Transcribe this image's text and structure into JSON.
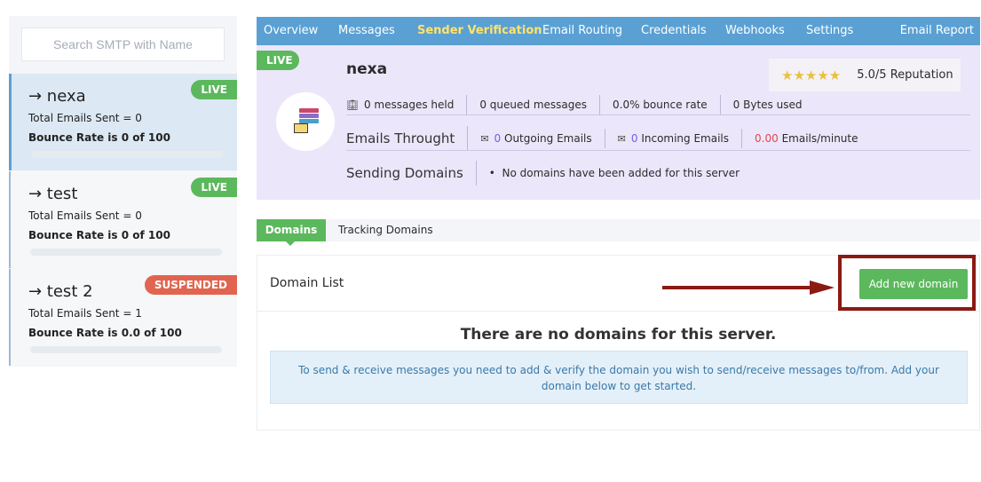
{
  "sidebar": {
    "search_placeholder": "Search SMTP with Name",
    "servers": [
      {
        "name": "→ nexa",
        "total_sent": "Total Emails Sent = 0",
        "bounce": "Bounce Rate is 0 of 100",
        "status": "LIVE"
      },
      {
        "name": "→ test",
        "total_sent": "Total Emails Sent = 0",
        "bounce": "Bounce Rate is 0 of 100",
        "status": "LIVE"
      },
      {
        "name": "→ test 2",
        "total_sent": "Total Emails Sent = 1",
        "bounce": "Bounce Rate is 0.0 of 100",
        "status": "SUSPENDED"
      }
    ]
  },
  "topnav": {
    "items": [
      "Overview",
      "Messages",
      "Sender Verification",
      "Email Routing",
      "Credentials",
      "Webhooks",
      "Settings",
      "Email Report"
    ],
    "active": "Sender Verification"
  },
  "server_panel": {
    "status": "LIVE",
    "name": "nexa",
    "reputation_stars": "★★★★★",
    "reputation_text": "5.0/5 Reputation",
    "stats": {
      "held": "0 messages held",
      "queued": "0 queued messages",
      "bounce_rate": "0.0% bounce rate",
      "bytes": "0 Bytes used"
    },
    "throughput": {
      "label": "Emails Throught",
      "outgoing_value": "0",
      "outgoing_label": "Outgoing Emails",
      "incoming_value": "0",
      "incoming_label": "Incoming Emails",
      "rate_value": "0.00",
      "rate_label": "Emails/minute"
    },
    "sending_domains": {
      "label": "Sending Domains",
      "text": "No domains have been added for this server"
    }
  },
  "tabs": {
    "domains": "Domains",
    "tracking": "Tracking Domains"
  },
  "domain_card": {
    "title": "Domain List",
    "add_button": "Add new domain",
    "empty_title": "There are no domains for this server.",
    "info": "To send & receive messages you need to add & verify the domain you wish to send/receive messages to/from. Add your domain below to get started."
  },
  "colors": {
    "nav": "#5aa0d3",
    "active_nav": "#ffe36b",
    "live": "#5cb85c",
    "suspended": "#e0644f",
    "panel": "#ece6fa",
    "annotation": "#8b1a12"
  }
}
